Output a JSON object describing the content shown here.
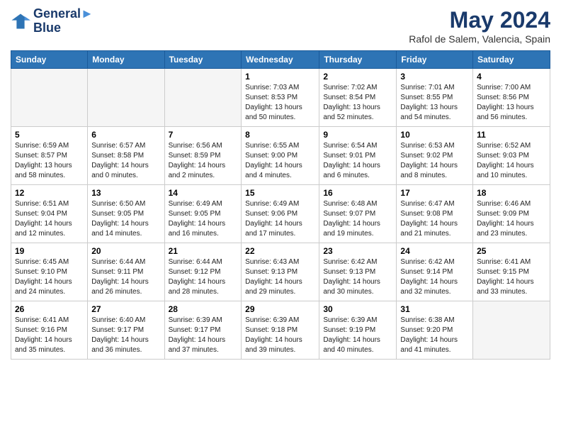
{
  "header": {
    "logo_line1": "General",
    "logo_line2": "Blue",
    "month_title": "May 2024",
    "location": "Rafol de Salem, Valencia, Spain"
  },
  "weekdays": [
    "Sunday",
    "Monday",
    "Tuesday",
    "Wednesday",
    "Thursday",
    "Friday",
    "Saturday"
  ],
  "weeks": [
    [
      {
        "day": "",
        "empty": true
      },
      {
        "day": "",
        "empty": true
      },
      {
        "day": "",
        "empty": true
      },
      {
        "day": "1",
        "sunrise": "7:03 AM",
        "sunset": "8:53 PM",
        "daylight": "13 hours and 50 minutes."
      },
      {
        "day": "2",
        "sunrise": "7:02 AM",
        "sunset": "8:54 PM",
        "daylight": "13 hours and 52 minutes."
      },
      {
        "day": "3",
        "sunrise": "7:01 AM",
        "sunset": "8:55 PM",
        "daylight": "13 hours and 54 minutes."
      },
      {
        "day": "4",
        "sunrise": "7:00 AM",
        "sunset": "8:56 PM",
        "daylight": "13 hours and 56 minutes."
      }
    ],
    [
      {
        "day": "5",
        "sunrise": "6:59 AM",
        "sunset": "8:57 PM",
        "daylight": "13 hours and 58 minutes."
      },
      {
        "day": "6",
        "sunrise": "6:57 AM",
        "sunset": "8:58 PM",
        "daylight": "14 hours and 0 minutes."
      },
      {
        "day": "7",
        "sunrise": "6:56 AM",
        "sunset": "8:59 PM",
        "daylight": "14 hours and 2 minutes."
      },
      {
        "day": "8",
        "sunrise": "6:55 AM",
        "sunset": "9:00 PM",
        "daylight": "14 hours and 4 minutes."
      },
      {
        "day": "9",
        "sunrise": "6:54 AM",
        "sunset": "9:01 PM",
        "daylight": "14 hours and 6 minutes."
      },
      {
        "day": "10",
        "sunrise": "6:53 AM",
        "sunset": "9:02 PM",
        "daylight": "14 hours and 8 minutes."
      },
      {
        "day": "11",
        "sunrise": "6:52 AM",
        "sunset": "9:03 PM",
        "daylight": "14 hours and 10 minutes."
      }
    ],
    [
      {
        "day": "12",
        "sunrise": "6:51 AM",
        "sunset": "9:04 PM",
        "daylight": "14 hours and 12 minutes."
      },
      {
        "day": "13",
        "sunrise": "6:50 AM",
        "sunset": "9:05 PM",
        "daylight": "14 hours and 14 minutes."
      },
      {
        "day": "14",
        "sunrise": "6:49 AM",
        "sunset": "9:05 PM",
        "daylight": "14 hours and 16 minutes."
      },
      {
        "day": "15",
        "sunrise": "6:49 AM",
        "sunset": "9:06 PM",
        "daylight": "14 hours and 17 minutes."
      },
      {
        "day": "16",
        "sunrise": "6:48 AM",
        "sunset": "9:07 PM",
        "daylight": "14 hours and 19 minutes."
      },
      {
        "day": "17",
        "sunrise": "6:47 AM",
        "sunset": "9:08 PM",
        "daylight": "14 hours and 21 minutes."
      },
      {
        "day": "18",
        "sunrise": "6:46 AM",
        "sunset": "9:09 PM",
        "daylight": "14 hours and 23 minutes."
      }
    ],
    [
      {
        "day": "19",
        "sunrise": "6:45 AM",
        "sunset": "9:10 PM",
        "daylight": "14 hours and 24 minutes."
      },
      {
        "day": "20",
        "sunrise": "6:44 AM",
        "sunset": "9:11 PM",
        "daylight": "14 hours and 26 minutes."
      },
      {
        "day": "21",
        "sunrise": "6:44 AM",
        "sunset": "9:12 PM",
        "daylight": "14 hours and 28 minutes."
      },
      {
        "day": "22",
        "sunrise": "6:43 AM",
        "sunset": "9:13 PM",
        "daylight": "14 hours and 29 minutes."
      },
      {
        "day": "23",
        "sunrise": "6:42 AM",
        "sunset": "9:13 PM",
        "daylight": "14 hours and 30 minutes."
      },
      {
        "day": "24",
        "sunrise": "6:42 AM",
        "sunset": "9:14 PM",
        "daylight": "14 hours and 32 minutes."
      },
      {
        "day": "25",
        "sunrise": "6:41 AM",
        "sunset": "9:15 PM",
        "daylight": "14 hours and 33 minutes."
      }
    ],
    [
      {
        "day": "26",
        "sunrise": "6:41 AM",
        "sunset": "9:16 PM",
        "daylight": "14 hours and 35 minutes."
      },
      {
        "day": "27",
        "sunrise": "6:40 AM",
        "sunset": "9:17 PM",
        "daylight": "14 hours and 36 minutes."
      },
      {
        "day": "28",
        "sunrise": "6:39 AM",
        "sunset": "9:17 PM",
        "daylight": "14 hours and 37 minutes."
      },
      {
        "day": "29",
        "sunrise": "6:39 AM",
        "sunset": "9:18 PM",
        "daylight": "14 hours and 39 minutes."
      },
      {
        "day": "30",
        "sunrise": "6:39 AM",
        "sunset": "9:19 PM",
        "daylight": "14 hours and 40 minutes."
      },
      {
        "day": "31",
        "sunrise": "6:38 AM",
        "sunset": "9:20 PM",
        "daylight": "14 hours and 41 minutes."
      },
      {
        "day": "",
        "empty": true
      }
    ]
  ]
}
